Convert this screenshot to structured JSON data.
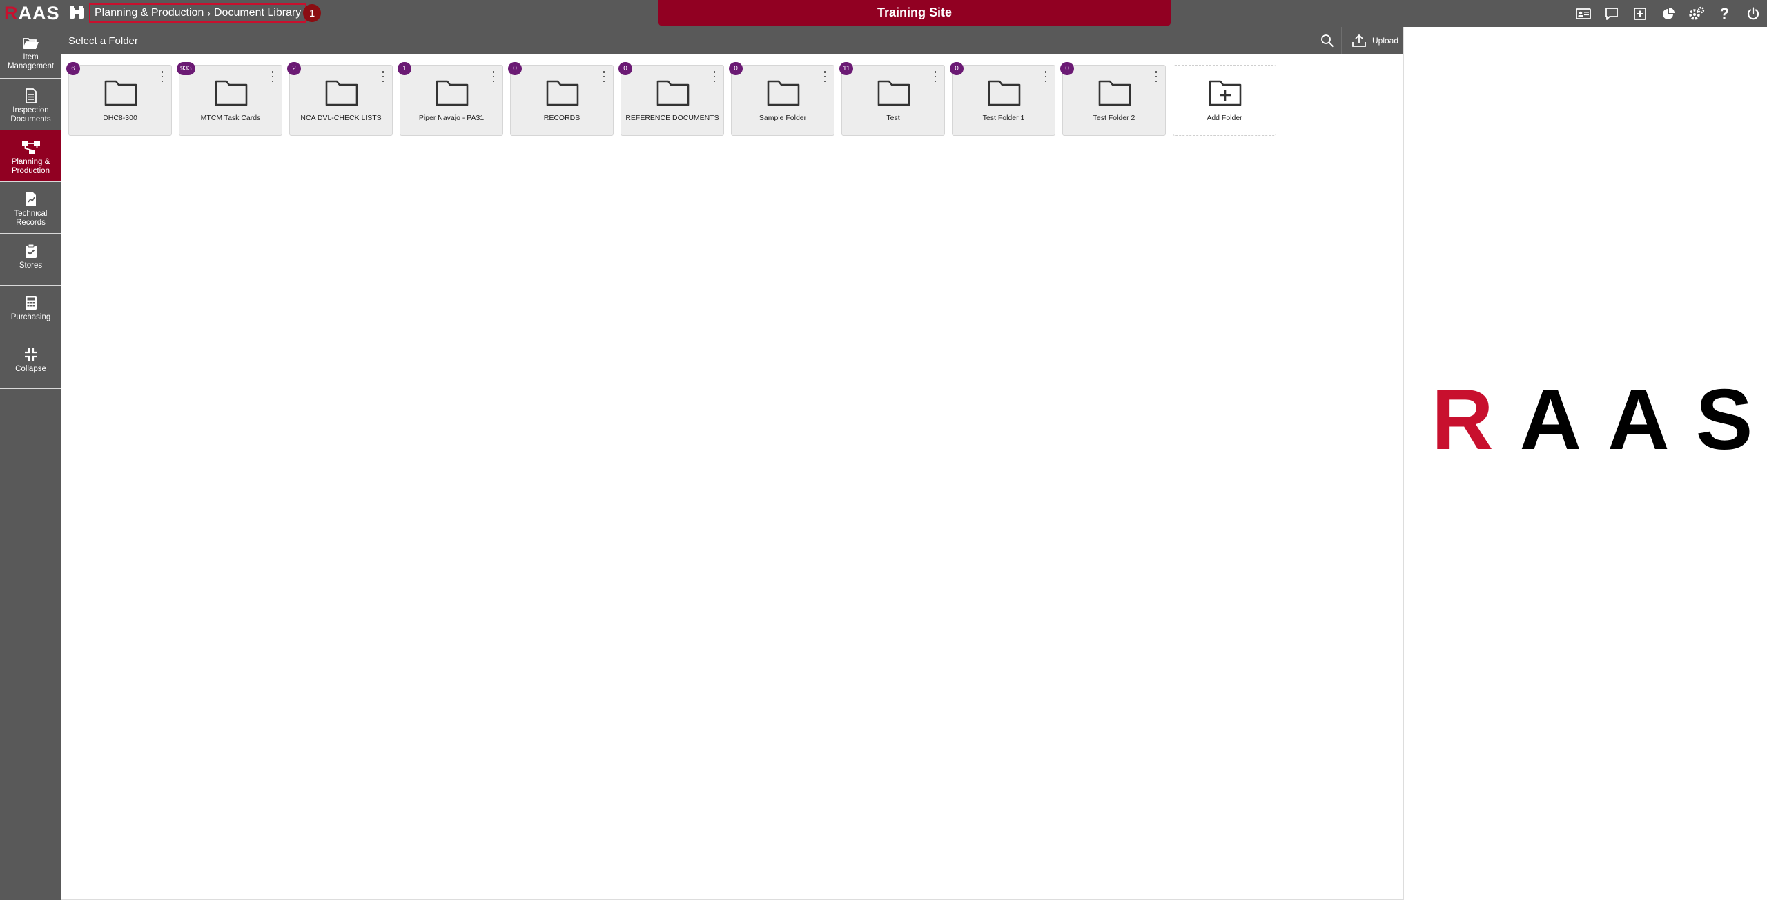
{
  "app": {
    "logo_text": "RAAS",
    "site_title": "Training Site"
  },
  "breadcrumb": {
    "section": "Planning & Production",
    "page": "Document Library",
    "badge": "1"
  },
  "top_icons": [
    "id-card-icon",
    "chat-icon",
    "add-box-icon",
    "pie-chart-icon",
    "gears-icon",
    "help-icon",
    "power-icon"
  ],
  "sidebar": {
    "items": [
      {
        "label": "Item Management",
        "icon": "folder-open-icon"
      },
      {
        "label": "Inspection Documents",
        "icon": "document-icon"
      },
      {
        "label": "Planning & Production",
        "icon": "sitemap-icon",
        "active": true
      },
      {
        "label": "Technical Records",
        "icon": "file-chart-icon"
      },
      {
        "label": "Stores",
        "icon": "clipboard-check-icon"
      },
      {
        "label": "Purchasing",
        "icon": "calculator-icon"
      },
      {
        "label": "Collapse",
        "icon": "compress-icon"
      }
    ]
  },
  "subheader": {
    "title": "Select a Folder",
    "upload_label": "Upload"
  },
  "folders": [
    {
      "name": "DHC8-300",
      "count": "6"
    },
    {
      "name": "MTCM Task Cards",
      "count": "933"
    },
    {
      "name": "NCA DVL-CHECK LISTS",
      "count": "2"
    },
    {
      "name": "Piper Navajo - PA31",
      "count": "1"
    },
    {
      "name": "RECORDS",
      "count": "0"
    },
    {
      "name": "REFERENCE DOCUMENTS",
      "count": "0"
    },
    {
      "name": "Sample Folder",
      "count": "0"
    },
    {
      "name": "Test",
      "count": "11"
    },
    {
      "name": "Test Folder 1",
      "count": "0"
    },
    {
      "name": "Test Folder 2",
      "count": "0"
    }
  ],
  "add_folder_label": "Add Folder",
  "colors": {
    "brand_red": "#910022",
    "chrome_gray": "#595959",
    "badge_purple": "#6b1a74"
  }
}
